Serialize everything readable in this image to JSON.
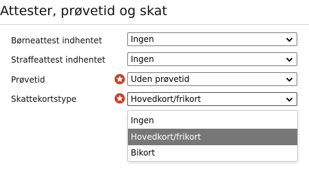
{
  "section": {
    "title": "Attester, prøvetid og skat"
  },
  "fields": [
    {
      "label": "Børneattest indhentet",
      "value": "Ingen",
      "required": false
    },
    {
      "label": "Straffeattest indhentet",
      "value": "Ingen",
      "required": false
    },
    {
      "label": "Prøvetid",
      "value": "Uden prøvetid",
      "required": true
    },
    {
      "label": "Skattekortstype",
      "value": "Hovedkort/frikort",
      "required": true
    }
  ],
  "dropdown": {
    "options": [
      "Ingen",
      "Hovedkort/frikort",
      "Bikort"
    ],
    "selected": "Hovedkort/frikort"
  },
  "colors": {
    "required_icon": "#cc3e26",
    "selected_option_bg": "#777777"
  },
  "icons": {
    "required": "star-circle-icon",
    "select_arrow": "chevron-down-icon"
  }
}
